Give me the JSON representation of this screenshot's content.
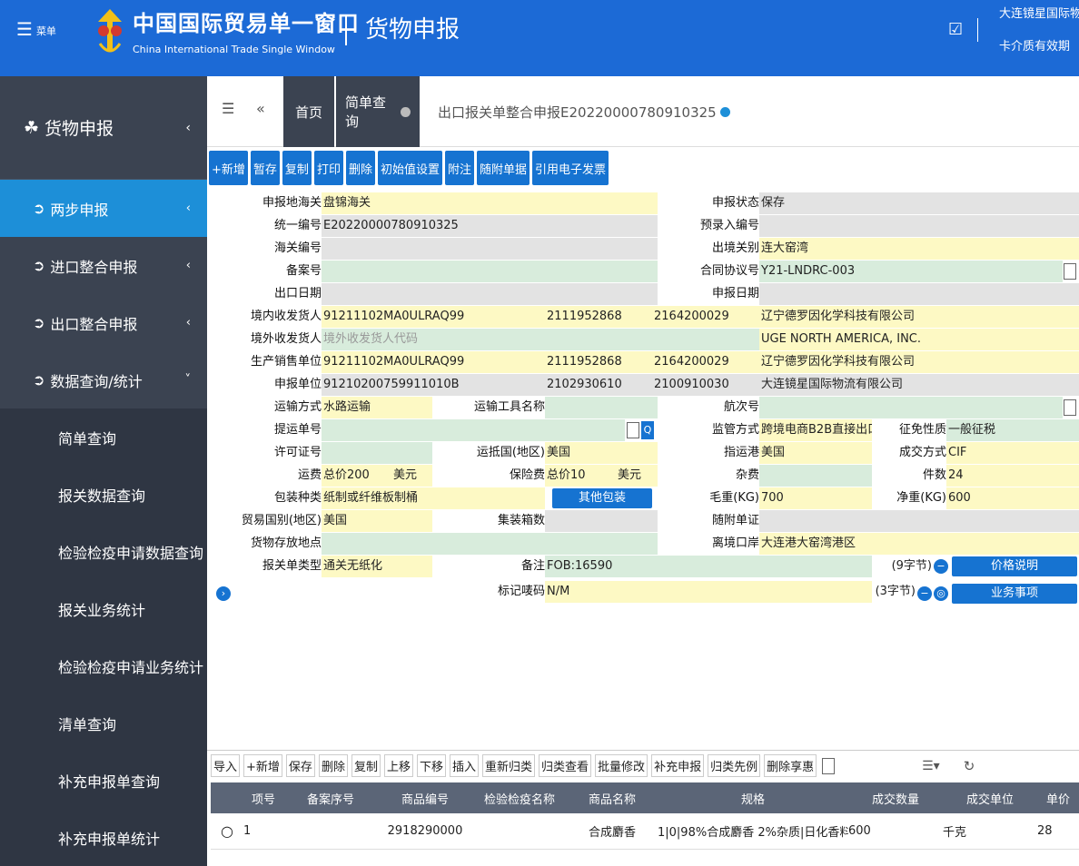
{
  "header": {
    "menu_label": "☰",
    "menu_text": "菜单",
    "brand_cn": "中国国际贸易单一窗口",
    "brand_en": "China International Trade Single Window",
    "module": "货物申报",
    "user_org": "大连镜星国际物",
    "user_card": "卡介质有效期"
  },
  "sidebar": {
    "top": "货物申报",
    "items": [
      {
        "label": "两步申报",
        "chev": "‹"
      },
      {
        "label": "进口整合申报",
        "chev": "‹"
      },
      {
        "label": "出口整合申报",
        "chev": "‹"
      },
      {
        "label": "数据查询/统计",
        "chev": "˅"
      }
    ],
    "subs": [
      "简单查询",
      "报关数据查询",
      "检验检疫申请数据查询",
      "报关业务统计",
      "检验检疫申请业务统计",
      "清单查询",
      "补充申报单查询",
      "补充申报单统计"
    ]
  },
  "tabs": {
    "home": "首页",
    "query": "简单查询",
    "current": "出口报关单整合申报E20220000780910325"
  },
  "toolbar": [
    "+新增",
    "暂存",
    "复制",
    "打印",
    "删除",
    "初始值设置",
    "附注",
    "随附单据",
    "引用电子发票"
  ],
  "form": {
    "l_port": "申报地海关",
    "v_port": "盘锦海关",
    "l_status": "申报状态",
    "v_status": "保存",
    "l_uid": "统一编号",
    "v_uid": "E20220000780910325",
    "l_pre": "预录入编号",
    "v_pre": "",
    "l_cusno": "海关编号",
    "v_cusno": "",
    "l_ie_port": "出境关别",
    "v_ie_port": "连大窑湾",
    "l_record": "备案号",
    "v_record": "",
    "l_contract": "合同协议号",
    "v_contract": "Y21-LNDRC-003",
    "l_out_date": "出口日期",
    "v_out_date": "",
    "l_decl_date": "申报日期",
    "v_decl_date": "",
    "l_consignor": "境内收发货人",
    "v_consignor_code": "91211102MA0ULRAQ99",
    "v_consignor_c2": "2111952868",
    "v_consignor_c3": "2164200029",
    "v_consignor_name": "辽宁德罗因化学科技有限公司",
    "l_overseas": "境外收发货人",
    "v_overseas_ph": "境外收发货人代码",
    "v_overseas_name": "UGE NORTH AMERICA, INC.",
    "l_producer": "生产销售单位",
    "v_producer_code": "91211102MA0ULRAQ99",
    "v_producer_c2": "2111952868",
    "v_producer_c3": "2164200029",
    "v_producer_name": "辽宁德罗因化学科技有限公司",
    "l_agent": "申报单位",
    "v_agent_code": "91210200759911010B",
    "v_agent_c2": "2102930610",
    "v_agent_c3": "2100910030",
    "v_agent_name": "大连镜星国际物流有限公司",
    "l_trans": "运输方式",
    "v_trans": "水路运输",
    "l_vessel": "运输工具名称",
    "v_vessel": "",
    "l_voyage": "航次号",
    "v_voyage": "",
    "l_bl": "提运单号",
    "v_bl": "",
    "l_trade": "监管方式",
    "v_trade": "跨境电商B2B直接出口",
    "l_levy": "征免性质",
    "v_levy": "一般征税",
    "l_license": "许可证号",
    "v_license": "",
    "l_dest_country": "运抵国(地区)",
    "v_dest_country": "美国",
    "l_dest_port": "指运港",
    "v_dest_port": "美国",
    "l_terms": "成交方式",
    "v_terms": "CIF",
    "l_freight": "运费",
    "v_freight": "总价200",
    "v_freight_cur": "美元",
    "l_insur": "保险费",
    "v_insur": "总价10",
    "v_insur_cur": "美元",
    "l_other": "杂费",
    "v_other": "",
    "l_pkgs": "件数",
    "v_pkgs": "24",
    "l_pack": "包装种类",
    "v_pack": "纸制或纤维板制桶",
    "b_otherpack": "其他包装",
    "l_gross": "毛重(KG)",
    "v_gross": "700",
    "l_net": "净重(KG)",
    "v_net": "600",
    "l_trade_country": "贸易国别(地区)",
    "v_trade_country": "美国",
    "l_container": "集装箱数",
    "v_container": "",
    "l_attach": "随附单证",
    "v_attach": "",
    "l_goods_place": "货物存放地点",
    "v_goods_place": "",
    "l_leave_port": "离境口岸",
    "v_leave_port": "大连港大窑湾港区",
    "l_decl_type": "报关单类型",
    "v_decl_type": "通关无纸化",
    "l_remark": "备注",
    "v_remark": "FOB:16590",
    "v_chars9": "(9字节)",
    "b_price": "价格说明",
    "l_marks": "标记唛码",
    "v_marks": "N/M",
    "v_chars3": "(3字节)",
    "b_items": "业务事项"
  },
  "gridbar": [
    "导入",
    "+新增",
    "保存",
    "删除",
    "复制",
    "上移",
    "下移",
    "插入",
    "重新归类",
    "归类查看",
    "批量修改",
    "补充申报",
    "归类先例",
    "删除享惠"
  ],
  "grid": {
    "headers": [
      "项号",
      "备案序号",
      "商品编号",
      "检验检疫名称",
      "商品名称",
      "规格",
      "成交数量",
      "成交单位",
      "单价"
    ],
    "rows": [
      [
        "1",
        "",
        "2918290000",
        "",
        "合成麝香",
        "1|0|98%合成麝香 2%杂质|日化香料,",
        "600",
        "千克",
        "28"
      ]
    ]
  }
}
